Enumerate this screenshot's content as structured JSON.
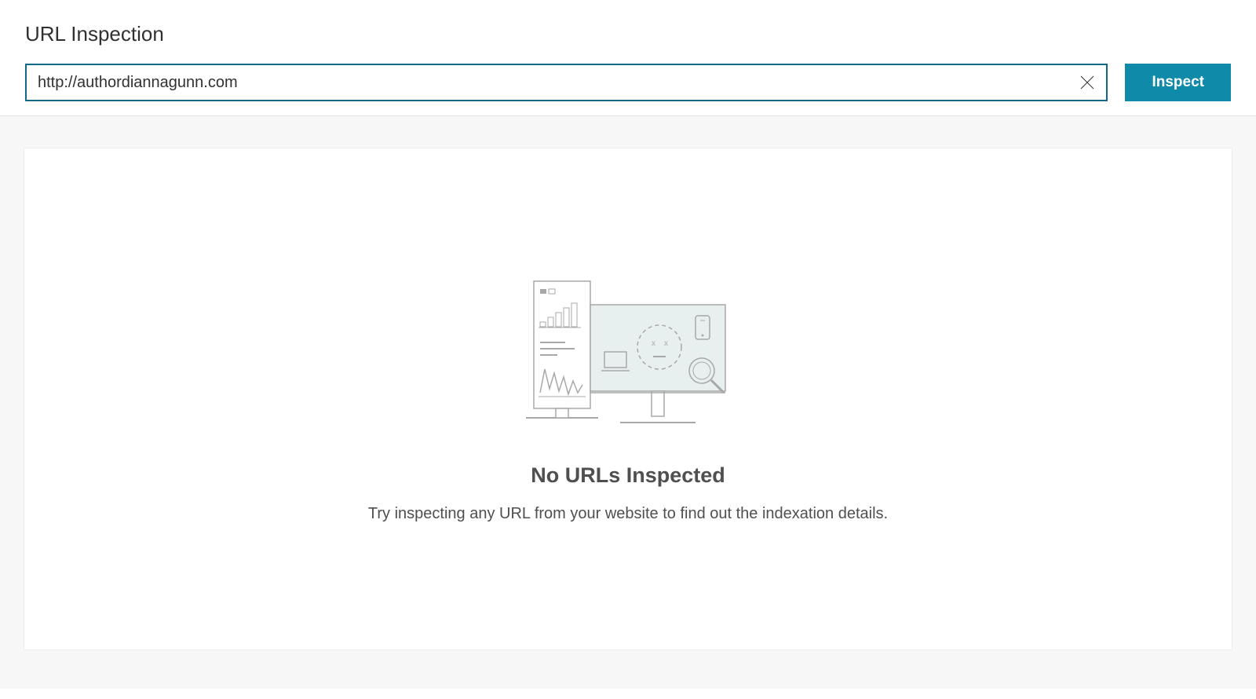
{
  "header": {
    "title": "URL Inspection",
    "url_input_value": "http://authordiannagunn.com",
    "inspect_button_label": "Inspect"
  },
  "empty_state": {
    "title": "No URLs Inspected",
    "description": "Try inspecting any URL from your website to find out the indexation details."
  },
  "icons": {
    "clear": "close-icon"
  },
  "colors": {
    "accent": "#0f8aa8",
    "border_focus": "#0f6a8a",
    "text_primary": "#323130",
    "text_secondary": "#4f4f4f",
    "bg_content": "#f7f7f7"
  }
}
